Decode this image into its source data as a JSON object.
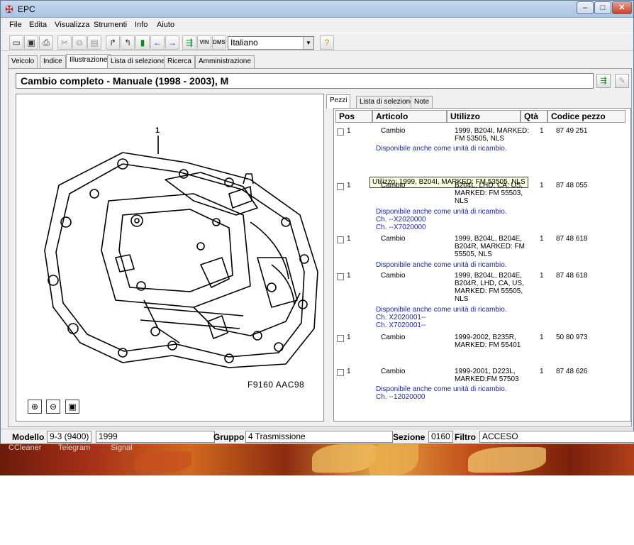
{
  "window": {
    "title": "EPC",
    "app_icon": "saab-griffin-icon"
  },
  "menu": [
    "File",
    "Edita",
    "Visualizza",
    "Strumenti",
    "Info",
    "Aiuto"
  ],
  "toolbar": {
    "language": "Italiano",
    "vin_label": "VIN",
    "dms_label": "DMS",
    "help_icon": "key-question-icon"
  },
  "tabs": [
    "Veicolo",
    "Indice",
    "Illustrazione",
    "Lista di selezione",
    "Ricerca",
    "Amministrazione"
  ],
  "active_tab": "Illustrazione",
  "header": {
    "title": "Cambio completo - Manuale   (1998 - 2003), M"
  },
  "illustration": {
    "callout": "1",
    "code": "F9160 AAC98"
  },
  "subtabs": [
    "Pezzi",
    "Lista di selezione",
    "Note"
  ],
  "active_subtab": "Pezzi",
  "columns": [
    "Pos",
    "Articolo",
    "Utilizzo",
    "Qtà",
    "Codice pezzo"
  ],
  "rows": [
    {
      "pos": "1",
      "article": "Cambio",
      "usage": [
        "1999, B204I,  MARKED:",
        "FM 53505, NLS"
      ],
      "qty": "1",
      "code": "87 49 251",
      "notes": [
        "Disponibile anche come unità di ricambio."
      ]
    },
    {
      "pos": "1",
      "article": "Cambio",
      "usage": [
        "B204L, LHD, CA, US,",
        "MARKED: FM 55503,",
        "NLS"
      ],
      "qty": "1",
      "code": "87 48 055",
      "notes": [
        "Disponibile anche come unità di ricambio.",
        "Ch. --X2020000",
        "Ch. --X7020000"
      ]
    },
    {
      "pos": "1",
      "article": "Cambio",
      "usage": [
        "1999, B204L, B204E,",
        "B204R,  MARKED: FM",
        "55505, NLS"
      ],
      "qty": "1",
      "code": "87 48 618",
      "notes": [
        "Disponibile anche come unità di ricambio."
      ]
    },
    {
      "pos": "1",
      "article": "Cambio",
      "usage": [
        "1999, B204L, B204E,",
        "B204R, LHD, CA, US,",
        "MARKED: FM 55505,",
        "NLS"
      ],
      "qty": "1",
      "code": "87 48 618",
      "notes": [
        "Disponibile anche come unità di ricambio.",
        "Ch. X2020001--",
        "Ch. X7020001--"
      ]
    },
    {
      "pos": "1",
      "article": "Cambio",
      "usage": [
        "1999-2002, B235R,",
        "MARKED: FM 55401"
      ],
      "qty": "1",
      "code": "50 80 973",
      "notes": []
    },
    {
      "pos": "1",
      "article": "Cambio",
      "usage": [
        "1999-2001, D223L,",
        "MARKED:FM 57503"
      ],
      "qty": "1",
      "code": "87 48 626",
      "notes": [
        "Disponibile anche come unità di ricambio.",
        "Ch. --12020000"
      ]
    }
  ],
  "tooltip": "Utilizzo: 1999, B204I,  MARKED: FM 53505, NLS",
  "status": {
    "modello_label": "Modello",
    "modello": "9-3 (9400)",
    "year": "1999",
    "gruppo_label": "Gruppo",
    "gruppo": "4 Trasmissione",
    "sezione_label": "Sezione",
    "sezione": "0160",
    "filtro_label": "Filtro",
    "filtro": "ACCESO"
  },
  "desktop": {
    "labels": [
      "CCleaner",
      "Telegram",
      "Signal"
    ]
  }
}
